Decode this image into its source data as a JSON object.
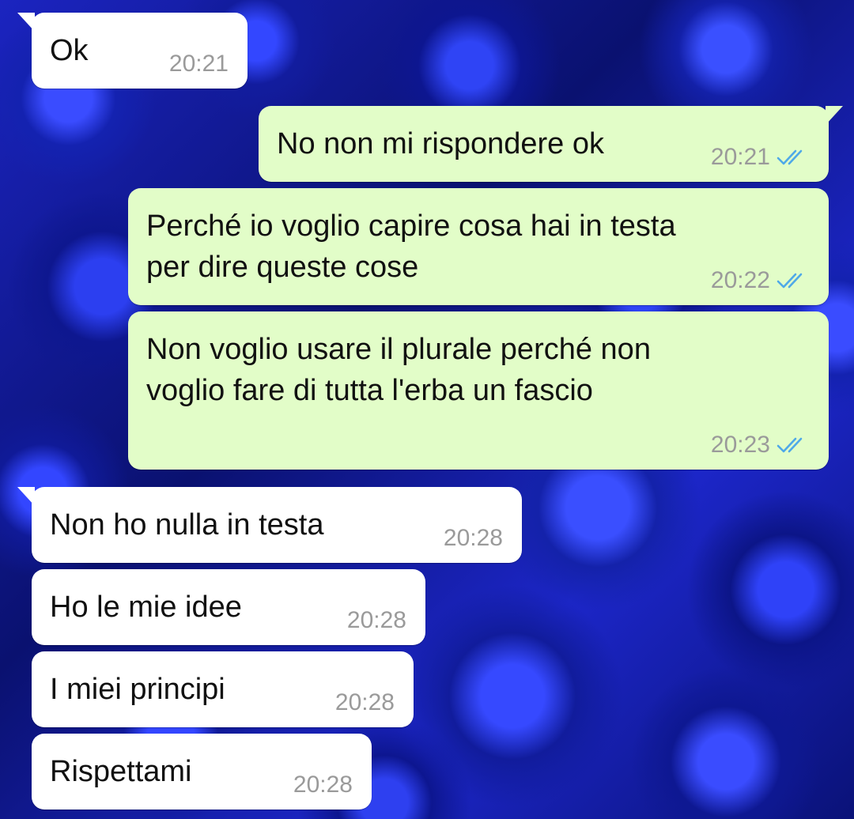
{
  "messages": [
    {
      "direction": "in",
      "text": "Ok",
      "time": "20:21"
    },
    {
      "direction": "out",
      "text": "No non mi rispondere ok",
      "time": "20:21",
      "status": "read-double-check-icon"
    },
    {
      "direction": "out",
      "text": "Perché io voglio capire cosa hai in testa\nper dire queste cose",
      "time": "20:22",
      "status": "read-double-check-icon"
    },
    {
      "direction": "out",
      "text": "Non voglio usare il plurale perché non\nvoglio fare di tutta l'erba un fascio",
      "time": "20:23",
      "status": "read-double-check-icon"
    },
    {
      "direction": "in",
      "text": "Non ho nulla in testa",
      "time": "20:28"
    },
    {
      "direction": "in",
      "text": "Ho le mie idee",
      "time": "20:28"
    },
    {
      "direction": "in",
      "text": "I miei principi",
      "time": "20:28"
    },
    {
      "direction": "in",
      "text": "Rispettami",
      "time": "20:28"
    }
  ],
  "colors": {
    "incoming_bubble": "#ffffff",
    "outgoing_bubble": "#e2fdc8",
    "read_ticks": "#4fa9e8",
    "timestamp": "#9a9a9a",
    "wallpaper": "#1a1fb8"
  },
  "wallpaper": "blue-roses"
}
